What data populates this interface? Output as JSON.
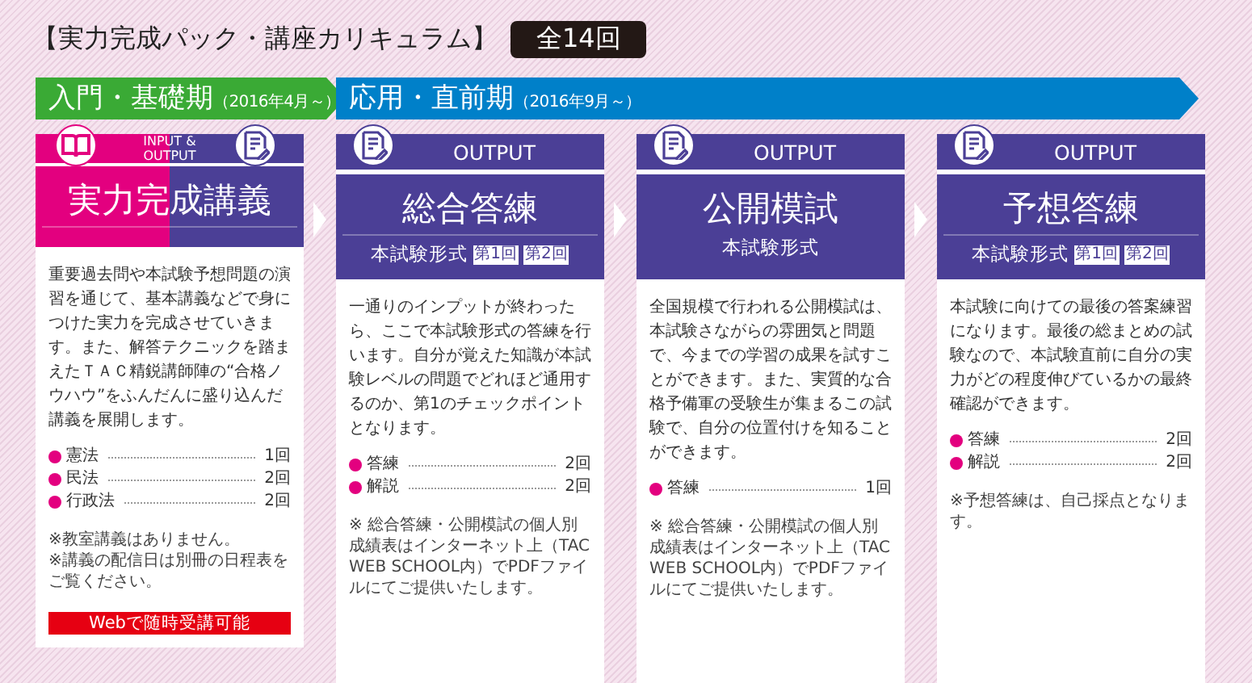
{
  "title": "【実力完成パック・講座カリキュラム】",
  "total_badge": "全14回",
  "phases": [
    {
      "name": "入門・基礎期",
      "period": "（2016年4月～）",
      "color": "#3aaa35"
    },
    {
      "name": "応用・直前期",
      "period": "（2016年9月～）",
      "color": "#0080c9"
    }
  ],
  "cards": [
    {
      "kind": "lecture",
      "header_label": [
        "INPUT &",
        "OUTPUT"
      ],
      "title": "実力完成講義",
      "description": "重要過去問や本試験予想問題の演習を通じて、基本講義などで身につけた実力を完成させていきます。また、解答テクニックを踏まえたＴＡＣ精鋭講師陣の“合格ノウハウ”をふんだんに盛り込んだ講義を展開します。",
      "items": [
        {
          "name": "憲法",
          "count": "1回"
        },
        {
          "name": "民法",
          "count": "2回"
        },
        {
          "name": "行政法",
          "count": "2回"
        }
      ],
      "notes": [
        "※教室講義はありません。",
        "※講義の配信日は別冊の日程表をご覧ください。"
      ],
      "web_badge": "Webで随時受講可能"
    },
    {
      "kind": "output",
      "header_label": [
        "OUTPUT"
      ],
      "title": "総合答練",
      "format": "本試験形式",
      "rounds": [
        "第1回",
        "第2回"
      ],
      "description": "一通りのインプットが終わったら、ここで本試験形式の答練を行います。自分が覚えた知識が本試験レベルの問題でどれほど通用するのか、第1のチェックポイントとなります。",
      "items": [
        {
          "name": "答練",
          "count": "2回"
        },
        {
          "name": "解説",
          "count": "2回"
        }
      ],
      "notes": [
        "※ 総合答練・公開模試の個人別成績表はインターネット上（TAC WEB SCHOOL内）でPDFファイルにてご提供いたします。"
      ]
    },
    {
      "kind": "output",
      "header_label": [
        "OUTPUT"
      ],
      "title": "公開模試",
      "format": "本試験形式",
      "description": "全国規模で行われる公開模試は、本試験さながらの雰囲気と問題で、今までの学習の成果を試すことができます。また、実質的な合格予備軍の受験生が集まるこの試験で、自分の位置付けを知ることができます。",
      "items": [
        {
          "name": "答練",
          "count": "1回"
        }
      ],
      "notes": [
        "※ 総合答練・公開模試の個人別成績表はインターネット上（TAC WEB SCHOOL内）でPDFファイルにてご提供いたします。"
      ]
    },
    {
      "kind": "output",
      "header_label": [
        "OUTPUT"
      ],
      "title": "予想答練",
      "format": "本試験形式",
      "rounds": [
        "第1回",
        "第2回"
      ],
      "description": "本試験に向けての最後の答案練習になります。最後の総まとめの試験なので、本試験直前に自分の実力がどの程度伸びているかの最終確認ができます。",
      "items": [
        {
          "name": "答練",
          "count": "2回"
        },
        {
          "name": "解説",
          "count": "2回"
        }
      ],
      "notes": [
        "※予想答練は、自己採点となります。"
      ]
    }
  ]
}
